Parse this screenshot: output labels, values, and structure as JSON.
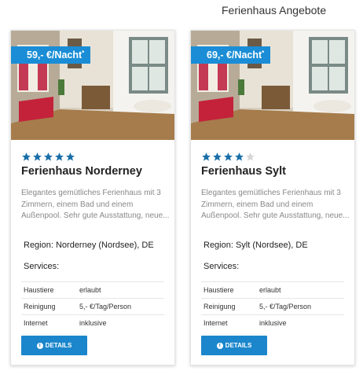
{
  "page": {
    "heading": "Ferienhaus Angebote"
  },
  "colors": {
    "accent": "#1a8dd6",
    "star_filled": "#1a6fa8",
    "star_empty": "#d6d6d6"
  },
  "cards": [
    {
      "price": "59,- €/Nacht",
      "price_marker": "*",
      "rating": 5,
      "rating_max": 5,
      "title": "Ferienhaus Norderney",
      "description": "Elegantes gemütliches Ferienhaus mit 3 Zimmern, einem Bad und einem Außenpool. Sehr gute Ausstattung, neue...",
      "region": "Region: Norderney (Nordsee), DE",
      "services_label": "Services:",
      "services": [
        {
          "key": "Haustiere",
          "value": "erlaubt"
        },
        {
          "key": "Reinigung",
          "value": "5,- €/Tag/Person"
        },
        {
          "key": "Internet",
          "value": "inklusive"
        }
      ],
      "details_label": "DETAILS",
      "details_icon": "info-icon"
    },
    {
      "price": "69,- €/Nacht",
      "price_marker": "*",
      "rating": 4,
      "rating_max": 5,
      "title": "Ferienhaus Sylt",
      "description": "Elegantes gemütliches Ferienhaus mit 3 Zimmern, einem Bad und einem Außenpool. Sehr gute Ausstattung, neue...",
      "region": "Region: Sylt (Nordsee), DE",
      "services_label": "Services:",
      "services": [
        {
          "key": "Haustiere",
          "value": "erlaubt"
        },
        {
          "key": "Reinigung",
          "value": "5,- €/Tag/Person"
        },
        {
          "key": "Internet",
          "value": "inklusive"
        }
      ],
      "details_label": "DETAILS",
      "details_icon": "info-icon"
    }
  ]
}
